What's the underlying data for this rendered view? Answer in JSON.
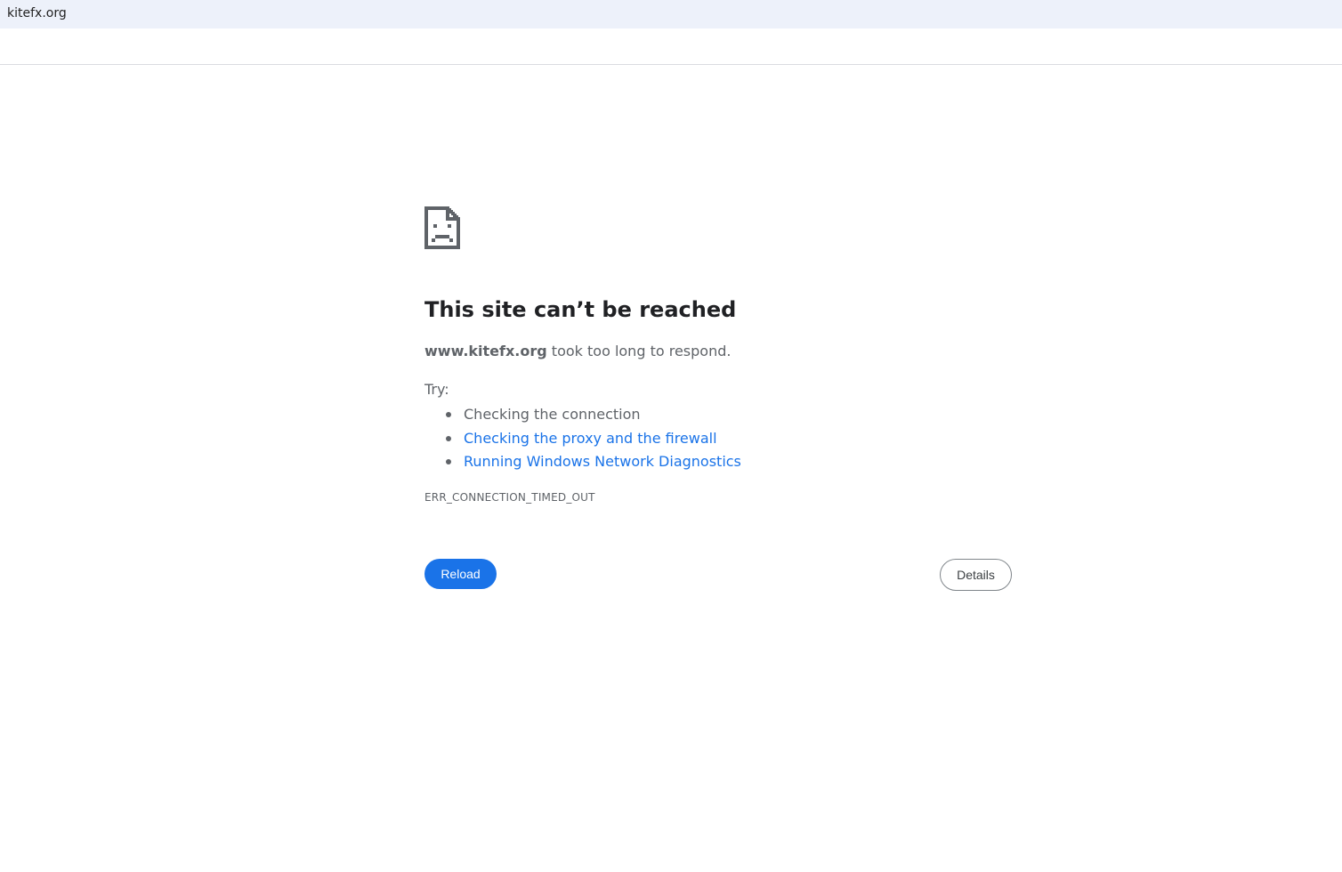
{
  "browser": {
    "url_text": "kitefx.org"
  },
  "error": {
    "icon": "sad-page-icon",
    "title": "This site can’t be reached",
    "host": "www.kitefx.org",
    "message_suffix": " took too long to respond.",
    "try_label": "Try:",
    "suggestions": [
      "Checking the connection",
      "Checking the proxy and the firewall",
      "Running Windows Network Diagnostics"
    ],
    "code": "ERR_CONNECTION_TIMED_OUT"
  },
  "buttons": {
    "reload_label": "Reload",
    "details_label": "Details"
  },
  "colors": {
    "accent": "#1a73e8",
    "text_secondary": "#5f6368",
    "title": "#202124",
    "topbar": "#edf1fa"
  }
}
